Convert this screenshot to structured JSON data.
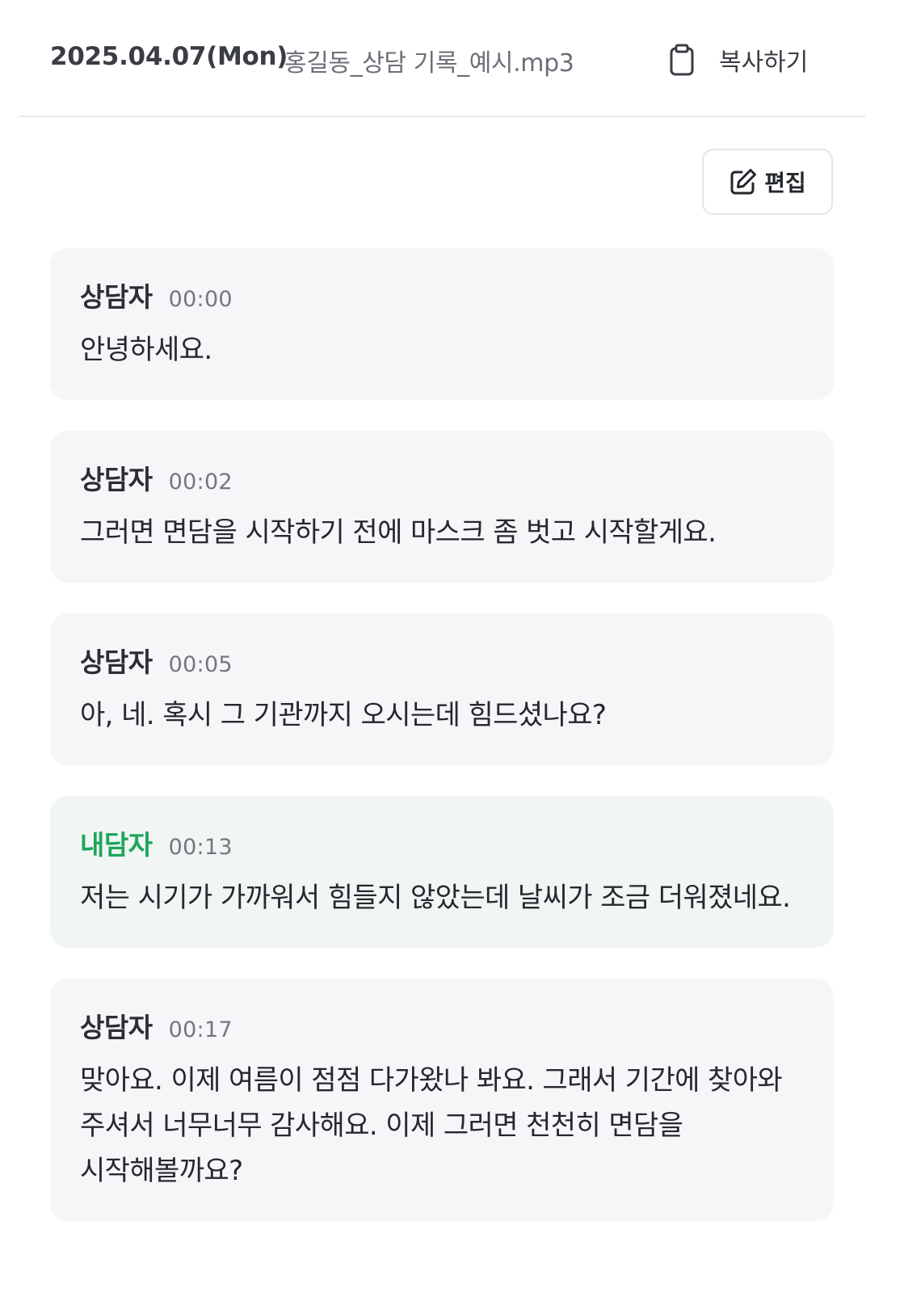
{
  "header": {
    "date": "2025.04.07(Mon)",
    "file_name": "홍길동_상담 기록_예시.mp3",
    "copy_label": "복사하기",
    "copy_icon": "clipboard-icon"
  },
  "toolbar": {
    "edit_label": "편집",
    "edit_icon": "edit-icon"
  },
  "colors": {
    "client_speaker": "#1ea55a",
    "counselor_bubble": "#f6f6f9",
    "client_bubble": "#f1f6f5"
  },
  "messages": [
    {
      "speaker": "상담자",
      "role": "counselor",
      "time": "00:00",
      "text": "안녕하세요."
    },
    {
      "speaker": "상담자",
      "role": "counselor",
      "time": "00:02",
      "text": "그러면 면담을 시작하기 전에 마스크 좀 벗고 시작할게요."
    },
    {
      "speaker": "상담자",
      "role": "counselor",
      "time": "00:05",
      "text": "아, 네. 혹시 그 기관까지 오시는데 힘드셨나요?"
    },
    {
      "speaker": "내담자",
      "role": "client",
      "time": "00:13",
      "text": "저는 시기가 가까워서 힘들지 않았는데 날씨가 조금 더워졌네요."
    },
    {
      "speaker": "상담자",
      "role": "counselor",
      "time": "00:17",
      "text": "맞아요. 이제 여름이 점점 다가왔나 봐요. 그래서 기간에 찾아와 주셔서 너무너무 감사해요. 이제 그러면 천천히 면담을 시작해볼까요?"
    }
  ]
}
